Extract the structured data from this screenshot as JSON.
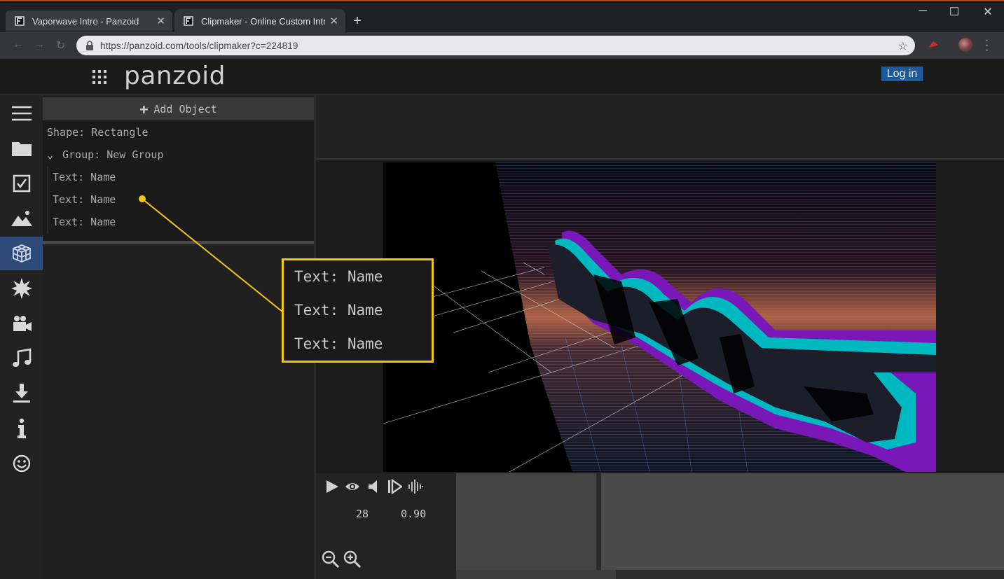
{
  "browser": {
    "tabs": [
      {
        "title": "Vaporwave Intro - Panzoid",
        "active": false
      },
      {
        "title": "Clipmaker - Online Custom Intro",
        "active": true
      }
    ],
    "url": "https://panzoid.com/tools/clipmaker?c=224819",
    "new_tab_label": "+"
  },
  "app": {
    "brand": "panzoid",
    "login_label": "Log in"
  },
  "rail": {
    "items": [
      {
        "icon": "menu-icon"
      },
      {
        "icon": "folder-icon"
      },
      {
        "icon": "checkbox-icon"
      },
      {
        "icon": "image-icon"
      },
      {
        "icon": "3d-cube-icon",
        "active": true
      },
      {
        "icon": "burst-icon"
      },
      {
        "icon": "video-camera-icon"
      },
      {
        "icon": "music-note-icon"
      },
      {
        "icon": "download-icon"
      },
      {
        "icon": "info-icon"
      },
      {
        "icon": "smiley-icon"
      }
    ]
  },
  "panel": {
    "add_object_label": "Add Object",
    "objects": {
      "shape": "Shape: Rectangle",
      "group": "Group: New Group",
      "children": [
        "Text: Name",
        "Text: Name",
        "Text: Name"
      ]
    }
  },
  "controls": {
    "frame": "28",
    "value": "0.90"
  },
  "callout": {
    "rows": [
      "Text: Name",
      "Text: Name",
      "Text: Name"
    ],
    "color": "#f5c518"
  },
  "colors": {
    "accent_blue": "#2e4a78",
    "login_bg": "#1f5a9a",
    "callout_yellow": "#f5c518",
    "text_cyan": "#00b8c0",
    "text_purple": "#7a17b8"
  }
}
